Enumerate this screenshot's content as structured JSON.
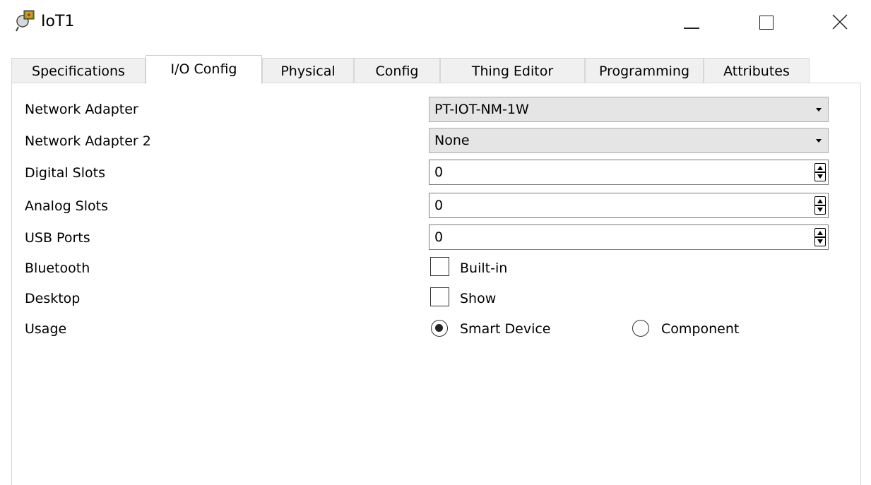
{
  "window": {
    "title": "IoT1"
  },
  "tabs": [
    {
      "label": "Specifications",
      "active": false
    },
    {
      "label": "I/O Config",
      "active": true
    },
    {
      "label": "Physical",
      "active": false
    },
    {
      "label": "Config",
      "active": false
    },
    {
      "label": "Thing Editor",
      "active": false
    },
    {
      "label": "Programming",
      "active": false
    },
    {
      "label": "Attributes",
      "active": false
    }
  ],
  "form": {
    "network_adapter": {
      "label": "Network Adapter",
      "value": "PT-IOT-NM-1W"
    },
    "network_adapter_2": {
      "label": "Network Adapter 2",
      "value": "None"
    },
    "digital_slots": {
      "label": "Digital Slots",
      "value": "0"
    },
    "analog_slots": {
      "label": "Analog Slots",
      "value": "0"
    },
    "usb_ports": {
      "label": "USB Ports",
      "value": "0"
    },
    "bluetooth": {
      "label": "Bluetooth",
      "option_label": "Built-in",
      "checked": false
    },
    "desktop": {
      "label": "Desktop",
      "option_label": "Show",
      "checked": false
    },
    "usage": {
      "label": "Usage",
      "options": [
        {
          "label": "Smart Device",
          "selected": true
        },
        {
          "label": "Component",
          "selected": false
        }
      ]
    }
  },
  "icons": {
    "app": "iot-device-icon",
    "minimize": "minimize-icon",
    "maximize": "maximize-icon",
    "close": "close-icon",
    "dropdown": "chevron-down-icon",
    "spinner": "spinner-arrows-icon"
  }
}
